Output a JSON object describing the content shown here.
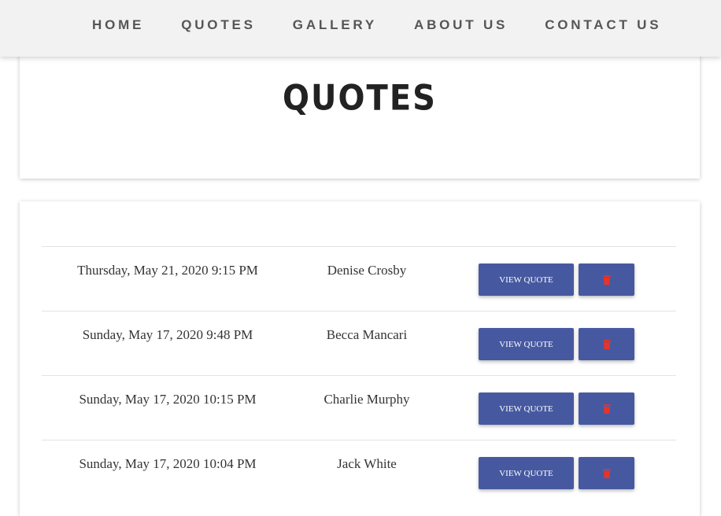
{
  "colors": {
    "nav_background": "#f2f2f2",
    "nav_text": "#555555",
    "button_background": "#4659a0",
    "button_text": "#ffffff",
    "trash_icon": "#e8332a",
    "body_text": "#333333"
  },
  "nav": {
    "items": [
      {
        "label": "HOME"
      },
      {
        "label": "QUOTES"
      },
      {
        "label": "GALLERY"
      },
      {
        "label": "ABOUT US"
      },
      {
        "label": "CONTACT US"
      }
    ]
  },
  "header": {
    "title": "QUOTES"
  },
  "quotes": {
    "rows": [
      {
        "date": "Thursday, May 21, 2020 9:15 PM",
        "author": "Denise Crosby",
        "view_label": "VIEW QUOTE",
        "delete_icon": "trash-icon"
      },
      {
        "date": "Sunday, May 17, 2020 9:48 PM",
        "author": "Becca Mancari",
        "view_label": "VIEW QUOTE",
        "delete_icon": "trash-icon"
      },
      {
        "date": "Sunday, May 17, 2020 10:15 PM",
        "author": "Charlie Murphy",
        "view_label": "VIEW QUOTE",
        "delete_icon": "trash-icon"
      },
      {
        "date": "Sunday, May 17, 2020 10:04 PM",
        "author": "Jack White",
        "view_label": "VIEW QUOTE",
        "delete_icon": "trash-icon"
      }
    ]
  }
}
